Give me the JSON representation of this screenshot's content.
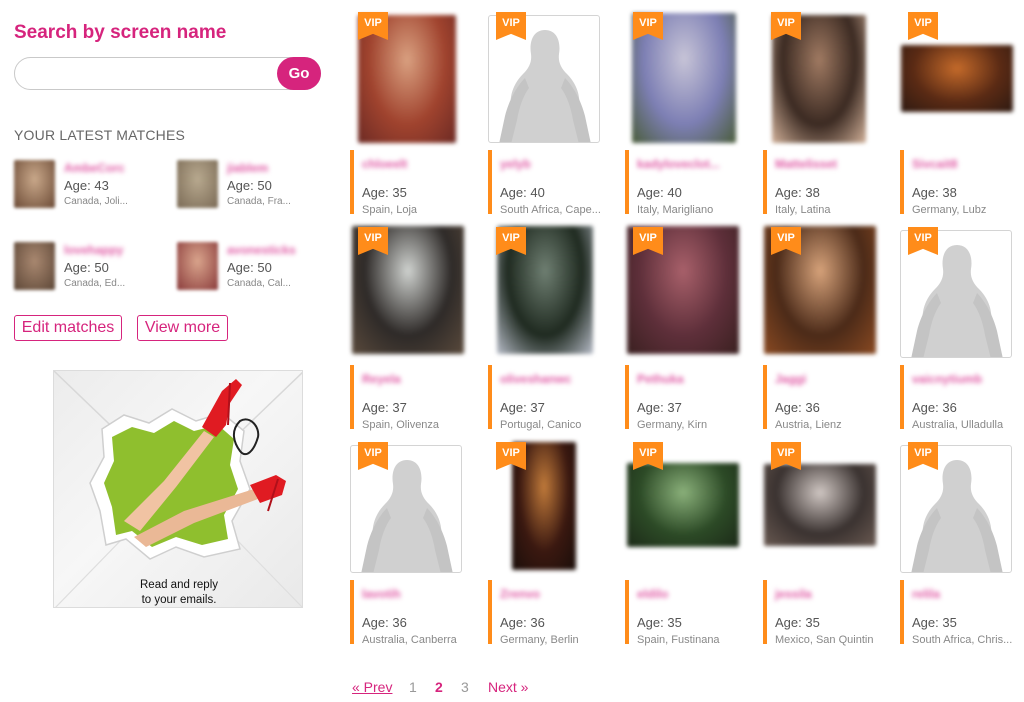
{
  "search": {
    "title": "Search by screen name",
    "placeholder": "",
    "value": "",
    "go_label": "Go"
  },
  "latest": {
    "heading": "YOUR LATEST MATCHES",
    "matches": [
      {
        "name": "AmbeCorc",
        "age": "Age: 43",
        "location": "Canada, Joli...",
        "colors": [
          "#6b4a35",
          "#c9a88a"
        ]
      },
      {
        "name": "jiablem",
        "age": "Age: 50",
        "location": "Canada, Fra...",
        "colors": [
          "#7a6a55",
          "#b8a98f"
        ]
      },
      {
        "name": "lovehappy",
        "age": "Age: 50",
        "location": "Canada, Ed...",
        "colors": [
          "#5c4636",
          "#a98870"
        ]
      },
      {
        "name": "avonesticks",
        "age": "Age: 50",
        "location": "Canada, Cal...",
        "colors": [
          "#8a3b3b",
          "#d9a48c"
        ]
      }
    ],
    "edit_label": "Edit matches",
    "more_label": "View more"
  },
  "promo": {
    "line1": "Read and reply",
    "line2": "to your emails."
  },
  "profiles": [
    {
      "vip": "VIP",
      "name": "chloeelt",
      "age": "Age: 35",
      "location": "Spain, Loja",
      "photo": {
        "type": "photo",
        "colors": [
          "#a0432e",
          "#d9a080",
          "#6c2a24"
        ]
      }
    },
    {
      "vip": "VIP",
      "name": "yelyb",
      "age": "Age: 40",
      "location": "South Africa, Cape...",
      "photo": {
        "type": "placeholder"
      }
    },
    {
      "vip": "VIP",
      "name": "kadyloveclot...",
      "age": "Age: 40",
      "location": "Italy, Marigliano",
      "photo": {
        "type": "photo",
        "colors": [
          "#7d7fb4",
          "#c7c4d7",
          "#4a5d3a"
        ]
      }
    },
    {
      "vip": "VIP",
      "name": "Mattelisset",
      "age": "Age: 38",
      "location": "Italy, Latina",
      "photo": {
        "type": "photo",
        "colors": [
          "#3b2a22",
          "#a07a62",
          "#d3b29a"
        ]
      }
    },
    {
      "vip": "VIP",
      "name": "Sivcait8",
      "age": "Age: 38",
      "location": "Germany, Lubz",
      "photo": {
        "type": "photo",
        "colors": [
          "#5a2a14",
          "#c46a2a",
          "#2e1a12"
        ]
      }
    },
    {
      "vip": "VIP",
      "name": "Reyela",
      "age": "Age: 37",
      "location": "Spain, Olivenza",
      "photo": {
        "type": "photo",
        "colors": [
          "#2e2a28",
          "#cfd2cf",
          "#5a4a3c"
        ]
      }
    },
    {
      "vip": "VIP",
      "name": "oliveshanwc",
      "age": "Age: 37",
      "location": "Portugal, Canico",
      "photo": {
        "type": "photo",
        "colors": [
          "#1f2a20",
          "#6f7f72",
          "#b8bdc9"
        ]
      }
    },
    {
      "vip": "VIP",
      "name": "Pethuka",
      "age": "Age: 37",
      "location": "Germany, Kirn",
      "photo": {
        "type": "photo",
        "colors": [
          "#5e2f3a",
          "#a8606a",
          "#3a2020"
        ]
      }
    },
    {
      "vip": "VIP",
      "name": "Jaggi",
      "age": "Age: 36",
      "location": "Austria, Lienz",
      "photo": {
        "type": "photo",
        "colors": [
          "#4b2a18",
          "#d6a27a",
          "#8a4a22"
        ]
      }
    },
    {
      "vip": "VIP",
      "name": "vaicnytiumb",
      "age": "Age: 36",
      "location": "Australia, Ulladulla",
      "photo": {
        "type": "placeholder"
      }
    },
    {
      "vip": "VIP",
      "name": "lavotih",
      "age": "Age: 36",
      "location": "Australia, Canberra",
      "photo": {
        "type": "placeholder"
      }
    },
    {
      "vip": "VIP",
      "name": "Zrenvo",
      "age": "Age: 36",
      "location": "Germany, Berlin",
      "photo": {
        "type": "photo",
        "colors": [
          "#3a1810",
          "#c07a3a",
          "#1a0e0a"
        ]
      }
    },
    {
      "vip": "VIP",
      "name": "eldilo",
      "age": "Age: 35",
      "location": "Spain, Fustinana",
      "photo": {
        "type": "photo",
        "colors": [
          "#2c4a26",
          "#8ab07a",
          "#1c2a18"
        ]
      }
    },
    {
      "vip": "VIP",
      "name": "jessila",
      "age": "Age: 35",
      "location": "Mexico, San Quintin",
      "photo": {
        "type": "photo",
        "colors": [
          "#3a3230",
          "#cfc6c2",
          "#6a5a52"
        ]
      }
    },
    {
      "vip": "VIP",
      "name": "relila",
      "age": "Age: 35",
      "location": "South Africa, Chris...",
      "photo": {
        "type": "placeholder"
      }
    }
  ],
  "pagination": {
    "prev": "« Prev",
    "pages": [
      "1",
      "2",
      "3"
    ],
    "current": "2",
    "next": "Next »"
  }
}
